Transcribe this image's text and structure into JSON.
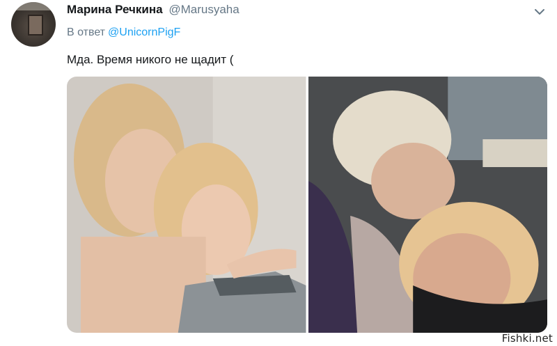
{
  "tweet": {
    "display_name": "Марина Речкина",
    "handle": "@Marusyaha",
    "reply_prefix": "В ответ",
    "reply_to": "@UnicornPigF",
    "text": "Мда. Время никого не щадит ("
  },
  "media": {
    "left_photo": "young-blonde-duo-photo",
    "right_photo": "elderly-women-embrace-photo"
  },
  "watermark": "Fishki.net",
  "colors": {
    "link": "#1da1f2",
    "secondary_text": "#657786",
    "primary_text": "#14171a"
  },
  "icons": {
    "menu": "chevron-down-icon"
  }
}
